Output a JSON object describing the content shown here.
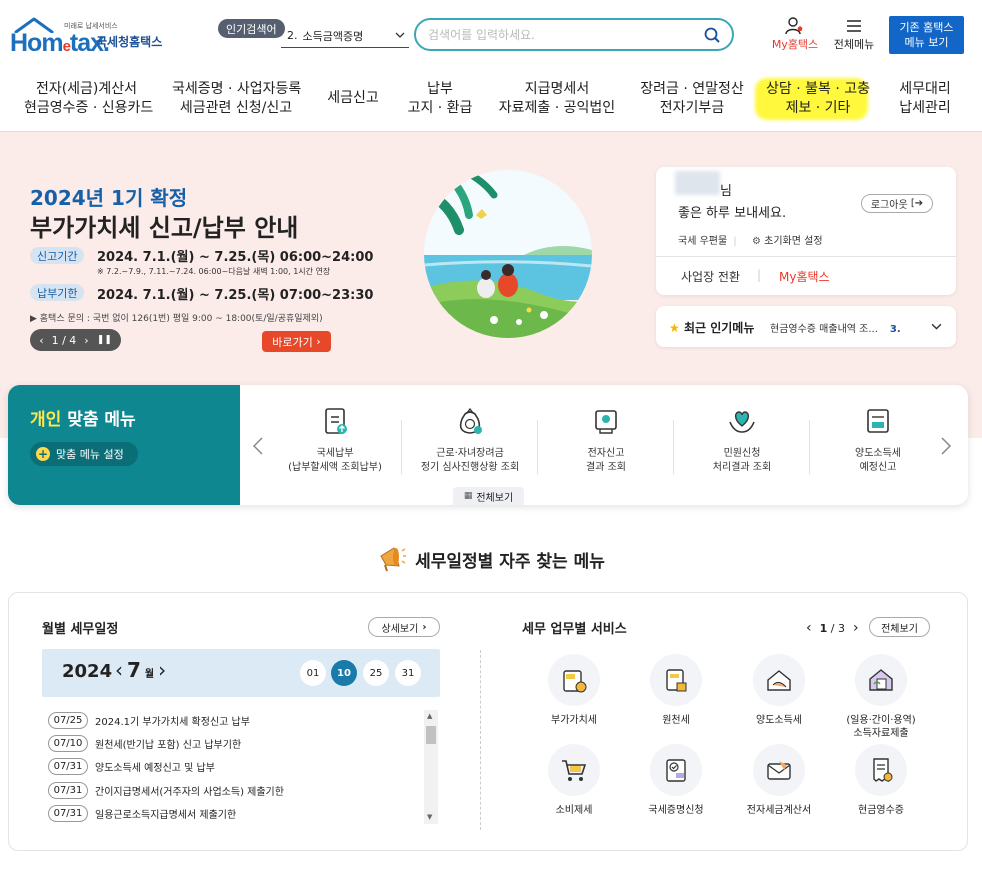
{
  "header": {
    "logo_small": "미래로 납세서비스",
    "logo_word_1": "Hom",
    "logo_word_2": "e",
    "logo_word_3": "tax.",
    "logo_name": "국세청홈택스",
    "popular_badge": "인기검색어",
    "popular_num": "2.",
    "popular_term": "소득금액증명",
    "search_placeholder": "검색어를 입력하세요.",
    "my_hometax": "My홈택스",
    "all_menu": "전체메뉴",
    "legacy_line1": "기존 홈택스",
    "legacy_line2": "메뉴 보기"
  },
  "gnb": [
    {
      "l1": "전자(세금)계산서",
      "l2": "현금영수증 · 신용카드"
    },
    {
      "l1": "국세증명 · 사업자등록",
      "l2": "세금관련 신청/신고"
    },
    {
      "l1": "세금신고",
      "l2": ""
    },
    {
      "l1": "납부",
      "l2": "고지 · 환급"
    },
    {
      "l1": "지급명세서",
      "l2": "자료제출 · 공익법인"
    },
    {
      "l1": "장려금 · 연말정산",
      "l2": "전자기부금"
    },
    {
      "l1": "상담 · 불복 · 고충",
      "l2": "제보 · 기타"
    },
    {
      "l1": "세무대리",
      "l2": "납세관리"
    }
  ],
  "hero": {
    "subtitle": "2024년 1기 확정",
    "title": "부가가치세 신고/납부 안내",
    "period_label": "신고기간",
    "period_value": "2024. 7.1.(월) ~ 7.25.(목) 06:00~24:00",
    "note": "※ 7.2.~7.9., 7.11.~7.24. 06:00~다음날 새벽 1:00, 1시간 연장",
    "payment_label": "납부기한",
    "payment_value": "2024. 7.1.(월) ~ 7.25.(목) 07:00~23:30",
    "inquiry": "▶ 홈택스 문의 : 국번 없이 126(1번) 평일 9:00 ~ 18:00(토/일/공휴일제외)",
    "pager": "1 / 4",
    "go_button": "바로가기"
  },
  "login": {
    "name_suffix": "님",
    "greeting": "좋은 하루 보내세요.",
    "logout": "로그아웃",
    "mailbox": "국세 우편물",
    "init_setting": "초기화면 설정",
    "biz_switch": "사업장 전환",
    "my_hometax": "My홈택스"
  },
  "recent": {
    "title": "최근 인기메뉴",
    "item": "현금영수증 매출내역 조...",
    "num": "3."
  },
  "custom_menu": {
    "title_hl": "개인",
    "title_rest": "맞춤 메뉴",
    "setting": "맞춤 메뉴 설정",
    "items": [
      {
        "l1": "국세납부",
        "l2": "(납부할세액 조회납부)"
      },
      {
        "l1": "근로·자녀장려금",
        "l2": "정기 심사진행상황 조회"
      },
      {
        "l1": "전자신고",
        "l2": "결과 조회"
      },
      {
        "l1": "민원신청",
        "l2": "처리결과 조회"
      },
      {
        "l1": "양도소득세",
        "l2": "예정신고"
      }
    ],
    "view_all": "전체보기"
  },
  "section": {
    "title": "세무일정별 자주 찾는 메뉴"
  },
  "calendar": {
    "title": "월별 세무일정",
    "more": "상세보기",
    "year": "2024",
    "month": "7",
    "month_unit": "월",
    "days": [
      "01",
      "10",
      "25",
      "31"
    ],
    "selected_day": "10",
    "schedule": [
      {
        "date": "07/25",
        "text": "2024.1기 부가가치세 확정신고 납부"
      },
      {
        "date": "07/10",
        "text": "원천세(반기납 포함) 신고 납부기한"
      },
      {
        "date": "07/31",
        "text": "양도소득세 예정신고 및 납부"
      },
      {
        "date": "07/31",
        "text": "간이지급명세서(거주자의 사업소득) 제출기한"
      },
      {
        "date": "07/31",
        "text": "일용근로소득지급명세서 제출기한"
      }
    ]
  },
  "services": {
    "title": "세무 업무별 서비스",
    "page_current": "1",
    "page_total": "/ 3",
    "view_all": "전체보기",
    "items": [
      {
        "l1": "부가가치세",
        "l2": ""
      },
      {
        "l1": "원천세",
        "l2": ""
      },
      {
        "l1": "양도소득세",
        "l2": ""
      },
      {
        "l1": "(일용·간이·용역)",
        "l2": "소득자료제출"
      },
      {
        "l1": "소비제세",
        "l2": ""
      },
      {
        "l1": "국세증명신청",
        "l2": ""
      },
      {
        "l1": "전자세금계산서",
        "l2": ""
      },
      {
        "l1": "현금영수증",
        "l2": ""
      }
    ]
  },
  "colors": {
    "brand_blue": "#1b6fbd",
    "accent_red": "#e8392a",
    "teal": "#0f8790",
    "highlight_yellow": "#fff833"
  }
}
